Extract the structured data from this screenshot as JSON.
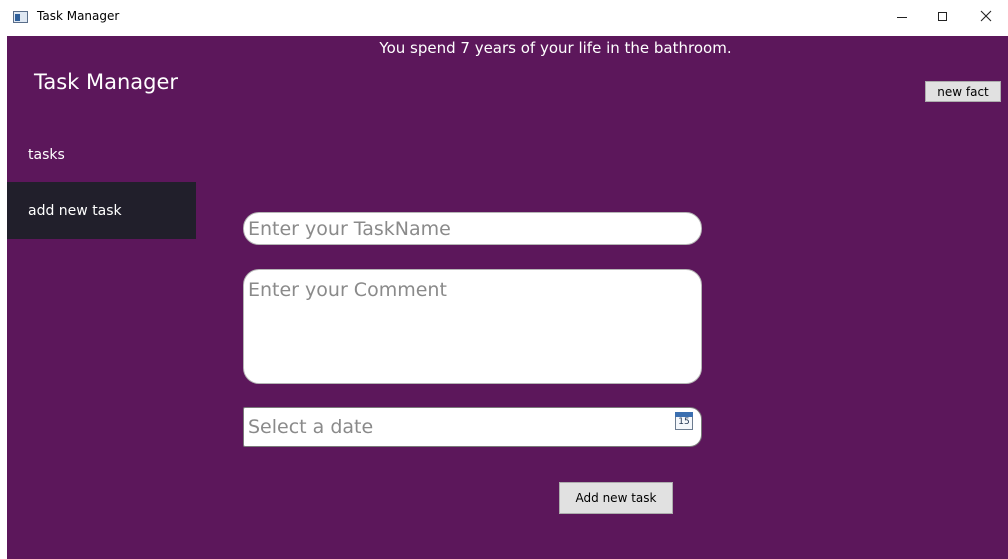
{
  "window": {
    "title": "Task Manager",
    "icon": "app-window-icon"
  },
  "header": {
    "fact": "You spend 7 years of your life in the bathroom.",
    "new_fact_label": "new fact"
  },
  "sidebar": {
    "brand": "Task Manager",
    "items": [
      {
        "label": "tasks",
        "selected": false
      },
      {
        "label": "add new task",
        "selected": true
      }
    ]
  },
  "form": {
    "task_name_placeholder": "Enter your TaskName",
    "task_name_value": "",
    "comment_placeholder": "Enter your Comment",
    "comment_value": "",
    "date_placeholder": "Select a date",
    "date_value": "",
    "calendar_day": "15",
    "submit_label": "Add new task"
  },
  "colors": {
    "background": "#5c175b",
    "selected_nav": "#211f2b",
    "text": "#ffffff"
  }
}
